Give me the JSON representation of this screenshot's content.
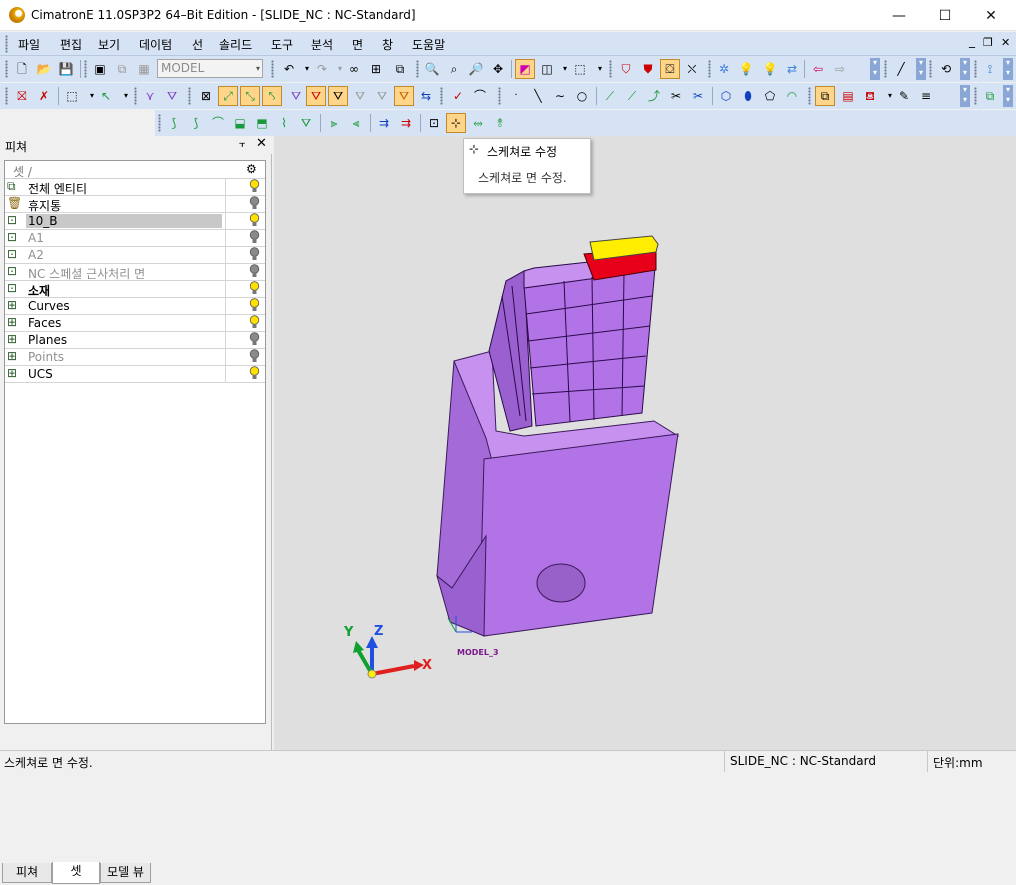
{
  "window": {
    "title": "CimatronE 11.0SP3P2 64–Bit Edition - [SLIDE_NC : NC-Standard]",
    "minimize_glyph": "—",
    "maximize_glyph": "☐",
    "close_glyph": "✕",
    "mdi_minimize_glyph": "_",
    "mdi_restore_glyph": "❐",
    "mdi_close_glyph": "✕"
  },
  "menu": [
    "파일",
    "편집",
    "보기",
    "데이텀",
    "선",
    "솔리드",
    "도구",
    "분석",
    "면",
    "창",
    "도움말"
  ],
  "toolbar": {
    "model_combo_value": "MODEL",
    "model_combo_arrow": "▾"
  },
  "panel": {
    "title": "피쳐",
    "pin_glyph": "⫟",
    "close_glyph": "✕",
    "table_header": "셋 /",
    "rows": [
      {
        "label": "전체 엔티티",
        "style": "normal",
        "bulb": "on"
      },
      {
        "label": "휴지통",
        "style": "normal",
        "bulb": "off"
      },
      {
        "label": "10_B",
        "style": "selected",
        "bulb": "on"
      },
      {
        "label": "A1",
        "style": "grey",
        "bulb": "off"
      },
      {
        "label": "A2",
        "style": "grey",
        "bulb": "off"
      },
      {
        "label": "NC 스페셜 근사처리 면",
        "style": "grey",
        "bulb": "off"
      },
      {
        "label": "소재",
        "style": "bold",
        "bulb": "on"
      },
      {
        "label": "Curves",
        "style": "normal",
        "bulb": "on"
      },
      {
        "label": "Faces",
        "style": "normal",
        "bulb": "on"
      },
      {
        "label": "Planes",
        "style": "normal",
        "bulb": "off"
      },
      {
        "label": "Points",
        "style": "grey",
        "bulb": "off"
      },
      {
        "label": "UCS",
        "style": "normal",
        "bulb": "on"
      }
    ],
    "tabs": [
      "피쳐",
      "셋",
      "모델 뷰"
    ],
    "active_tab": 1
  },
  "tooltip": {
    "title": "스케쳐로 수정",
    "description": "스케쳐로 면 수정."
  },
  "viewport": {
    "axis_x": "X",
    "axis_y": "Y",
    "axis_z": "Z",
    "model_ucs_label": "MODEL_3",
    "colors": {
      "part_face": "#b070e0",
      "part_top": "#c98ef0",
      "highlight_red": "#e8001a",
      "highlight_yellow": "#ffee00",
      "background": "#dfdfdf"
    }
  },
  "status": {
    "message": "스케쳐로 면 수정.",
    "document": "SLIDE_NC : NC-Standard",
    "units": "단위:mm"
  }
}
